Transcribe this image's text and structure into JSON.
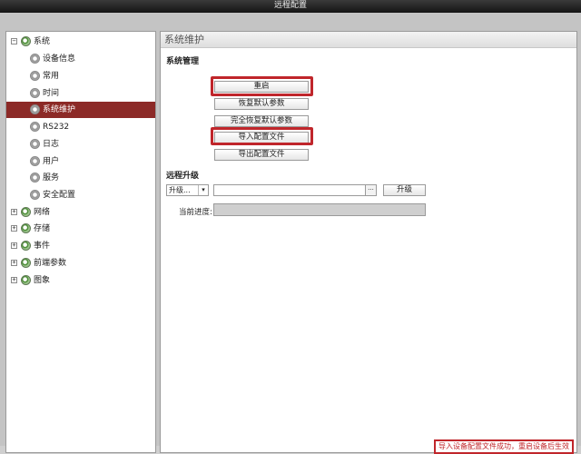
{
  "window": {
    "title": "远程配置"
  },
  "sidebar": {
    "items": [
      {
        "label": "系统",
        "level": 0,
        "expanded": true
      },
      {
        "label": "设备信息",
        "level": 1
      },
      {
        "label": "常用",
        "level": 1
      },
      {
        "label": "时间",
        "level": 1
      },
      {
        "label": "系统维护",
        "level": 1,
        "selected": true
      },
      {
        "label": "RS232",
        "level": 1
      },
      {
        "label": "日志",
        "level": 1
      },
      {
        "label": "用户",
        "level": 1
      },
      {
        "label": "服务",
        "level": 1
      },
      {
        "label": "安全配置",
        "level": 1
      },
      {
        "label": "网络",
        "level": 0
      },
      {
        "label": "存储",
        "level": 0
      },
      {
        "label": "事件",
        "level": 0
      },
      {
        "label": "前端参数",
        "level": 0
      },
      {
        "label": "图象",
        "level": 0
      }
    ]
  },
  "main": {
    "title": "系统维护",
    "system_management": {
      "heading": "系统管理",
      "reboot": "重启",
      "restore_defaults": "恢复默认参数",
      "full_restore_defaults": "完全恢复默认参数",
      "import_config": "导入配置文件",
      "export_config": "导出配置文件"
    },
    "remote_upgrade": {
      "heading": "远程升级",
      "select_value": "升级...",
      "path_value": "",
      "browse_label": "···",
      "upgrade_button": "升级",
      "progress_label": "当前进度:",
      "progress": 0
    }
  },
  "status_bar": {
    "message": "导入设备配置文件成功，重启设备后生效"
  },
  "colors": {
    "accent": "#8c2a27",
    "highlight": "#c0262b"
  }
}
